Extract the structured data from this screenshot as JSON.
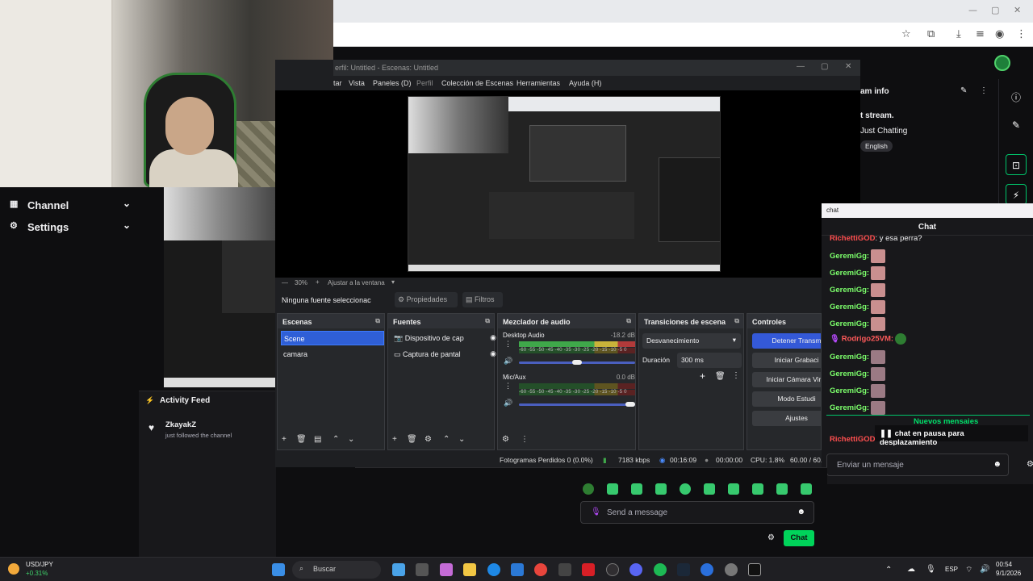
{
  "obs": {
    "title": "erfil: Untitled - Escenas: Untitled",
    "menu": [
      "tar",
      "Vista",
      "Paneles (D)",
      "Perfil",
      "Colección de Escenas",
      "Herramientas",
      "Ayuda (H)"
    ],
    "zoom": "30%",
    "fit": "Ajustar a la ventana",
    "no_source": "Ninguna fuente seleccionac",
    "properties": "Propiedades",
    "filters": "Filtros",
    "scenes_title": "Escenas",
    "scenes": [
      "Scene",
      "camara"
    ],
    "sources_title": "Fuentes",
    "sources": [
      "Dispositivo de cap",
      "Captura de pantal"
    ],
    "mixer_title": "Mezclador de audio",
    "tracks": [
      {
        "name": "Desktop Audio",
        "db": "-18.2 dB"
      },
      {
        "name": "Mic/Aux",
        "db": "0.0 dB"
      }
    ],
    "scale": "-60 -55 -50 -45 -40 -35 -30 -25 -20 -15 -10 -5 0",
    "transitions_title": "Transiciones de escena",
    "transition": "Desvanecimiento",
    "duration_label": "Duración",
    "duration": "300 ms",
    "controls_title": "Controles",
    "controls": [
      "Detener Transm",
      "Iniciar Grabaci",
      "Iniciar Cámara Virtu",
      "Modo Estudi",
      "Ajustes"
    ],
    "status": {
      "dropped": "Fotogramas Perdidos 0 (0.0%)",
      "kbps": "7183 kbps",
      "live": "00:16:09",
      "rec": "00:00:00",
      "cpu": "CPU: 1.8%",
      "fps": "60.00 / 60."
    }
  },
  "left_nav": {
    "items": [
      {
        "label": "Channel",
        "icon": "channel-icon"
      },
      {
        "label": "Settings",
        "icon": "gear-icon"
      }
    ]
  },
  "activity": {
    "title": "Activity Feed",
    "user": "ZkayakZ",
    "event": "just followed the channel"
  },
  "stream_info": {
    "title": "am info",
    "line1": "t stream.",
    "category": "Just Chatting",
    "tag": "English"
  },
  "chat": {
    "popout_label": "chat",
    "header": "Chat",
    "messages": [
      {
        "user": "RichettiGOD",
        "text": ": y esa perra?",
        "color": "#ff4f4f"
      },
      {
        "user": "GeremiGg:",
        "text": "",
        "color": "#7cff6b"
      },
      {
        "user": "GeremiGg:",
        "text": "",
        "color": "#7cff6b"
      },
      {
        "user": "GeremiGg:",
        "text": "",
        "color": "#7cff6b"
      },
      {
        "user": "GeremiGg:",
        "text": "",
        "color": "#7cff6b"
      },
      {
        "user": "GeremiGg:",
        "text": "",
        "color": "#7cff6b"
      },
      {
        "user": "Rodrigo25VM:",
        "text": "",
        "color": "#ff5a5a"
      },
      {
        "user": "GeremiGg:",
        "text": "",
        "color": "#7cff6b"
      },
      {
        "user": "GeremiGg:",
        "text": "",
        "color": "#7cff6b"
      },
      {
        "user": "GeremiGg:",
        "text": "",
        "color": "#7cff6b"
      },
      {
        "user": "GeremiGg:",
        "text": "",
        "color": "#7cff6b"
      }
    ],
    "new_messages": "Nuevos mensaies",
    "last_user": "RichettiGOD:",
    "paused": "chat en pausa para desplazamiento",
    "input_placeholder": "Enviar un mensaje"
  },
  "bottom_chat": {
    "placeholder": "Send a message",
    "chat_button": "Chat"
  },
  "taskbar": {
    "ticker": "USD/JPY",
    "ticker_change": "+0.31%",
    "search": "Buscar",
    "lang": "ESP",
    "time": "00:54",
    "date": "9/1/2026"
  },
  "colors": {
    "twitch_green": "#00d45a",
    "obs_blue": "#3459d8"
  }
}
